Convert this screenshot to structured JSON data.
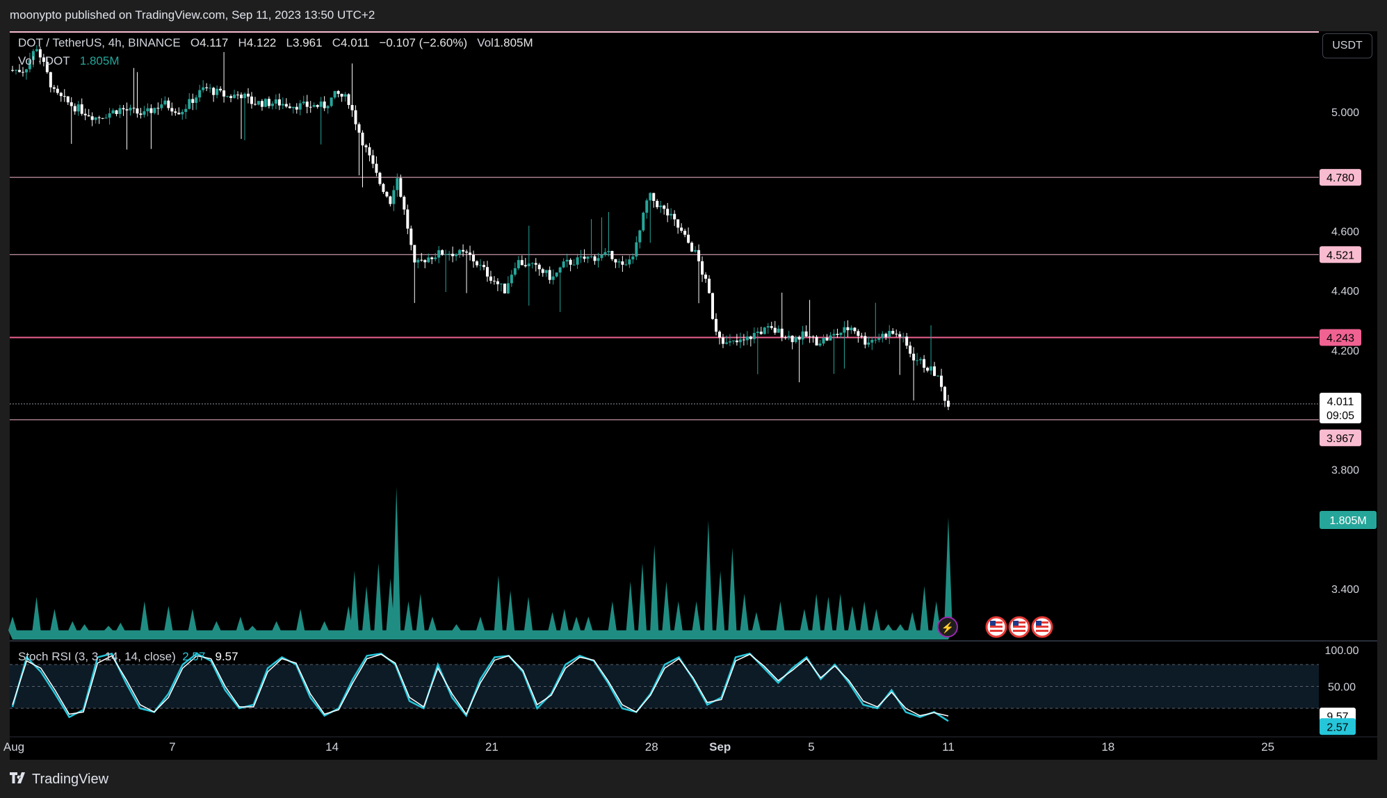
{
  "publisher": {
    "text": "moonypto published on TradingView.com, Sep 11, 2023 13:50 UTC+2"
  },
  "legend": {
    "symbol": "DOT / TetherUS, 4h, BINANCE",
    "o_label": "O",
    "o_value": "4.117",
    "h_label": "H",
    "h_value": "4.122",
    "l_label": "L",
    "l_value": "3.961",
    "c_label": "C",
    "c_value": "4.011",
    "change": "−0.107 (−2.60%)",
    "vol_label": "Vol",
    "vol_value": "1.805M",
    "vol_row_label": "Vol · DOT",
    "vol_row_value": "1.805M"
  },
  "stoch_legend": {
    "label": "Stoch RSI (3, 3, 14, 14, close)",
    "k_value": "2.57",
    "d_value": "9.57"
  },
  "currency_button": "USDT",
  "brand": "TradingView",
  "colors": {
    "up": "#26a69a",
    "down": "#ffffff",
    "volume": "#26a69a",
    "level_line": "#f8bbd0",
    "level_strong": "#f06292",
    "stoch_k": "#26c6da",
    "stoch_d": "#ffffff"
  },
  "chart_data": [
    {
      "type": "candlestick",
      "symbol": "DOT / TetherUS",
      "interval": "4h",
      "exchange": "BINANCE",
      "ylim": [
        3.23,
        5.27
      ],
      "y_ticks": [
        "5.000",
        "4.600",
        "4.400",
        "4.200",
        "3.800",
        "3.400"
      ],
      "x_ticks": [
        "Aug",
        "7",
        "14",
        "21",
        "28",
        "Sep",
        "5",
        "11",
        "18",
        "25"
      ],
      "horizontal_levels": [
        {
          "value": 4.78,
          "label": "4.780"
        },
        {
          "value": 4.521,
          "label": "4.521"
        },
        {
          "value": 4.243,
          "label": "4.243"
        },
        {
          "value": 3.967,
          "label": "3.967"
        }
      ],
      "last_price": {
        "value": 4.011,
        "label": "4.011",
        "countdown": "09:05"
      },
      "path_points": [
        [
          1,
          5.14
        ],
        [
          2,
          5.22
        ],
        [
          3.5,
          5.06
        ],
        [
          5,
          5.02
        ],
        [
          7,
          4.98
        ],
        [
          9,
          5.01
        ],
        [
          11,
          4.99
        ],
        [
          12.5,
          5.03
        ],
        [
          14,
          5.0
        ],
        [
          16,
          5.08
        ],
        [
          18,
          5.05
        ],
        [
          19,
          5.06
        ],
        [
          20,
          5.03
        ],
        [
          22,
          5.03
        ],
        [
          24,
          5.02
        ],
        [
          26,
          5.02
        ],
        [
          27,
          5.06
        ],
        [
          28,
          5.04
        ],
        [
          29,
          4.92
        ],
        [
          30,
          4.82
        ],
        [
          30.5,
          4.77
        ],
        [
          31.5,
          4.7
        ],
        [
          32,
          4.79
        ],
        [
          33,
          4.6
        ],
        [
          33.5,
          4.48
        ],
        [
          34.5,
          4.51
        ],
        [
          36,
          4.53
        ],
        [
          38,
          4.52
        ],
        [
          39,
          4.48
        ],
        [
          40,
          4.44
        ],
        [
          41,
          4.4
        ],
        [
          42,
          4.5
        ],
        [
          44,
          4.47
        ],
        [
          45,
          4.44
        ],
        [
          46,
          4.49
        ],
        [
          48,
          4.51
        ],
        [
          50,
          4.52
        ],
        [
          51,
          4.47
        ],
        [
          52,
          4.55
        ],
        [
          53,
          4.72
        ],
        [
          54,
          4.68
        ],
        [
          55,
          4.64
        ],
        [
          56,
          4.58
        ],
        [
          57,
          4.52
        ],
        [
          58,
          4.4
        ],
        [
          58.5,
          4.28
        ],
        [
          59.5,
          4.22
        ],
        [
          61,
          4.23
        ],
        [
          62,
          4.26
        ],
        [
          63,
          4.27
        ],
        [
          64,
          4.26
        ],
        [
          65,
          4.24
        ],
        [
          66,
          4.25
        ],
        [
          67,
          4.23
        ],
        [
          68,
          4.24
        ],
        [
          69,
          4.26
        ],
        [
          70,
          4.28
        ],
        [
          71,
          4.23
        ],
        [
          72,
          4.24
        ],
        [
          73,
          4.26
        ],
        [
          74,
          4.25
        ],
        [
          75,
          4.18
        ],
        [
          76,
          4.15
        ],
        [
          77,
          4.12
        ],
        [
          78,
          4.011
        ]
      ]
    },
    {
      "type": "area",
      "name": "Vol · DOT",
      "current_label": "1.805M",
      "peaks": [
        [
          0,
          0.15
        ],
        [
          2,
          0.28
        ],
        [
          3.5,
          0.2
        ],
        [
          5,
          0.12
        ],
        [
          6,
          0.1
        ],
        [
          8,
          0.09
        ],
        [
          9,
          0.11
        ],
        [
          11,
          0.25
        ],
        [
          13,
          0.22
        ],
        [
          15,
          0.2
        ],
        [
          17,
          0.12
        ],
        [
          19,
          0.15
        ],
        [
          20,
          0.09
        ],
        [
          22,
          0.12
        ],
        [
          24,
          0.2
        ],
        [
          26,
          0.12
        ],
        [
          28,
          0.22
        ],
        [
          28.5,
          0.45
        ],
        [
          29.5,
          0.35
        ],
        [
          30.5,
          0.5
        ],
        [
          31.5,
          0.4
        ],
        [
          32,
          1.0
        ],
        [
          33,
          0.25
        ],
        [
          34,
          0.3
        ],
        [
          35,
          0.15
        ],
        [
          37,
          0.1
        ],
        [
          39,
          0.15
        ],
        [
          40.5,
          0.42
        ],
        [
          41.5,
          0.32
        ],
        [
          43,
          0.28
        ],
        [
          45,
          0.18
        ],
        [
          46,
          0.2
        ],
        [
          47,
          0.15
        ],
        [
          48,
          0.15
        ],
        [
          50,
          0.25
        ],
        [
          51.5,
          0.38
        ],
        [
          52.5,
          0.5
        ],
        [
          53.5,
          0.62
        ],
        [
          54.5,
          0.38
        ],
        [
          55.5,
          0.25
        ],
        [
          57,
          0.25
        ],
        [
          58,
          0.78
        ],
        [
          59,
          0.45
        ],
        [
          60,
          0.6
        ],
        [
          61,
          0.3
        ],
        [
          62,
          0.18
        ],
        [
          64,
          0.25
        ],
        [
          66,
          0.2
        ],
        [
          67,
          0.3
        ],
        [
          68,
          0.28
        ],
        [
          69,
          0.3
        ],
        [
          70,
          0.22
        ],
        [
          71,
          0.25
        ],
        [
          72,
          0.2
        ],
        [
          73,
          0.1
        ],
        [
          74,
          0.1
        ],
        [
          75,
          0.18
        ],
        [
          76,
          0.35
        ],
        [
          77,
          0.25
        ],
        [
          78,
          0.8
        ]
      ]
    },
    {
      "type": "line",
      "name": "Stoch RSI (3, 3, 14, 14, close)",
      "ylim": [
        0,
        100
      ],
      "y_ticks": [
        "100.00",
        "50.00"
      ],
      "band": [
        20,
        80
      ],
      "series": [
        {
          "name": "K",
          "values": [
            22,
            90,
            70,
            40,
            8,
            18,
            90,
            95,
            55,
            20,
            15,
            40,
            80,
            95,
            85,
            45,
            20,
            25,
            75,
            90,
            80,
            35,
            10,
            20,
            60,
            92,
            95,
            80,
            30,
            20,
            80,
            35,
            10,
            60,
            90,
            92,
            70,
            20,
            40,
            80,
            92,
            85,
            55,
            20,
            15,
            40,
            80,
            90,
            60,
            25,
            35,
            90,
            95,
            75,
            55,
            75,
            90,
            60,
            80,
            55,
            25,
            20,
            45,
            15,
            8,
            15,
            2.57
          ]
        },
        {
          "name": "D",
          "values": [
            25,
            85,
            75,
            45,
            12,
            15,
            82,
            92,
            60,
            25,
            15,
            35,
            75,
            92,
            88,
            50,
            22,
            22,
            70,
            88,
            82,
            40,
            12,
            18,
            55,
            88,
            94,
            82,
            35,
            22,
            75,
            40,
            12,
            55,
            86,
            92,
            72,
            25,
            38,
            75,
            90,
            86,
            58,
            25,
            15,
            38,
            75,
            88,
            62,
            28,
            32,
            85,
            94,
            78,
            58,
            72,
            88,
            62,
            78,
            58,
            30,
            22,
            42,
            20,
            10,
            14,
            9.57
          ]
        }
      ]
    }
  ]
}
